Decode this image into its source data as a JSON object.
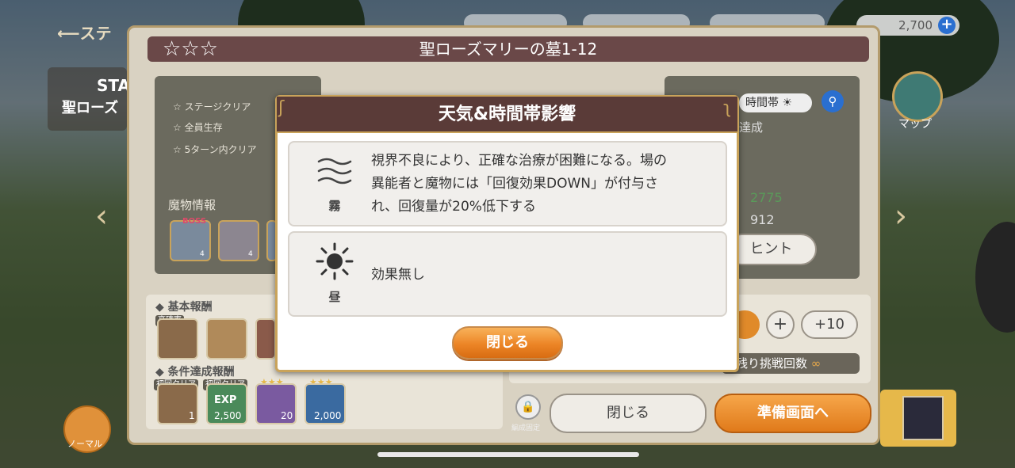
{
  "topbar": {
    "back_label": "ステ",
    "resource1_value": "2,700",
    "plus": "+"
  },
  "side": {
    "stage_label_top": "STA",
    "stage_label_name": "聖ローズ",
    "map_label": "マップ",
    "normal_label": "ノーマル"
  },
  "stage": {
    "title": "聖ローズマリーの墓1-12",
    "stars": [
      "☆",
      "☆",
      "☆"
    ],
    "missions": [
      "ステージクリア",
      "全員生存",
      "5ターン内クリア"
    ],
    "time_zone_label": "時間帯",
    "achievement_fragment": "達成",
    "monster_info_label": "魔物情報",
    "boss_label": "BOSS",
    "monster_levels": [
      "4",
      "4"
    ],
    "stat_value_green": "2775",
    "stat_value": "912",
    "hint_button": "ヒント",
    "stepper_plus": "+",
    "stepper_plus10": "+10",
    "remaining_label": "残り挑戦回数",
    "remaining_value": "∞",
    "basic_reward_label": "基本報酬",
    "high_rate_tag": "高確率",
    "condition_reward_label": "条件達成報酬",
    "first_clear_tag": "初回クリア",
    "reward_counts": [
      "1",
      "2,500",
      "20",
      "2,000"
    ],
    "exp_label": "EXP",
    "formation_lock_label": "編成固定",
    "close_button": "閉じる",
    "prepare_button": "準備画面へ"
  },
  "modal": {
    "title": "天気&時間帯影響",
    "fog_label": "霧",
    "fog_text_line1": "視界不良により、正確な治療が困難になる。場の",
    "fog_text_line2": "異能者と魔物には「回復効果DOWN」が付与さ",
    "fog_text_line3": "れ、回復量が20%低下する",
    "day_label": "昼",
    "day_text": "効果無し",
    "close_button": "閉じる"
  },
  "colors": {
    "modal_header": "#5a3b38",
    "gold_border": "#c9a35a",
    "orange_button": "#ec8526",
    "blue_plus": "#2a6fd0",
    "green_stat": "#5a9a5a"
  }
}
